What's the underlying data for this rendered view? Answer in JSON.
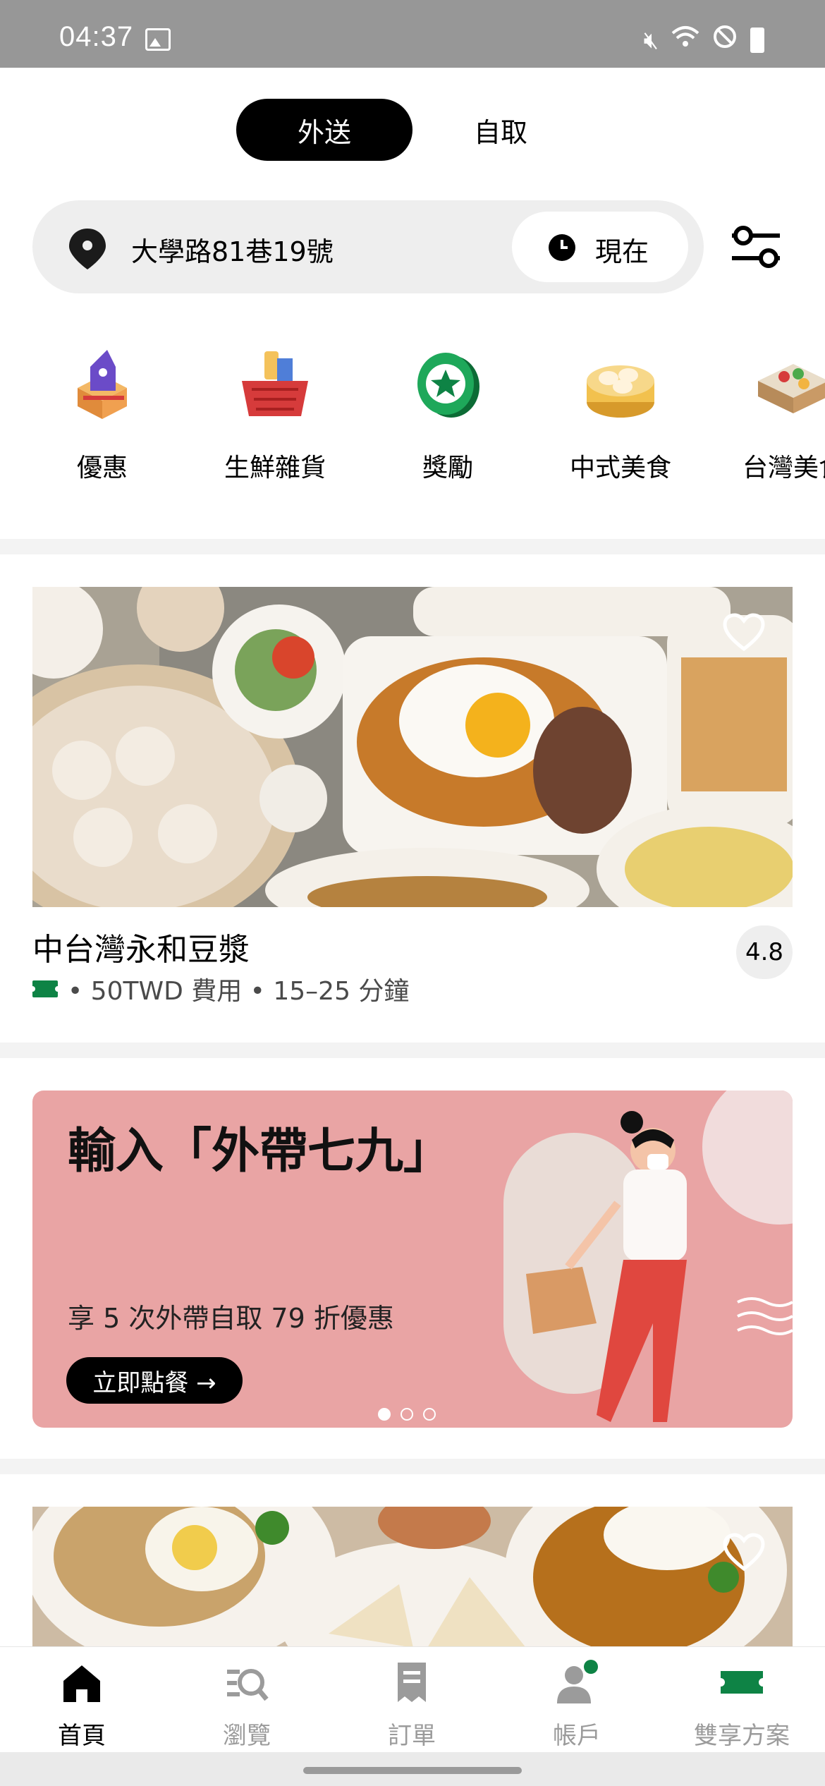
{
  "status_bar": {
    "time": "04:37"
  },
  "mode_tabs": {
    "delivery": "外送",
    "pickup": "自取"
  },
  "address_bar": {
    "address": "大學路81巷19號",
    "time_label": "現在"
  },
  "categories": [
    {
      "label": "優惠",
      "icon": "coupon-icon"
    },
    {
      "label": "生鮮雜貨",
      "icon": "grocery-basket-icon"
    },
    {
      "label": "獎勵",
      "icon": "star-badge-icon"
    },
    {
      "label": "中式美食",
      "icon": "dumpling-steamer-icon"
    },
    {
      "label": "台灣美食",
      "icon": "bento-box-icon"
    }
  ],
  "store": {
    "name": "中台灣永和豆漿",
    "fee": "• 50TWD 費用 • 15–25 分鐘",
    "rating": "4.8"
  },
  "promo": {
    "title": "輸入「外帶七九」",
    "subtitle": "享 5 次外帶自取 79 折優惠",
    "button": "立即點餐 →"
  },
  "bottom_nav": [
    {
      "label": "首頁",
      "icon": "home-icon",
      "active": true
    },
    {
      "label": "瀏覽",
      "icon": "browse-search-icon",
      "active": false
    },
    {
      "label": "訂單",
      "icon": "receipt-icon",
      "active": false
    },
    {
      "label": "帳戶",
      "icon": "account-icon",
      "active": false
    },
    {
      "label": "雙享方案",
      "icon": "ticket-icon",
      "active": false
    }
  ],
  "colors": {
    "accent_green": "#0e8345",
    "promo_bg": "#e9a4a4"
  }
}
